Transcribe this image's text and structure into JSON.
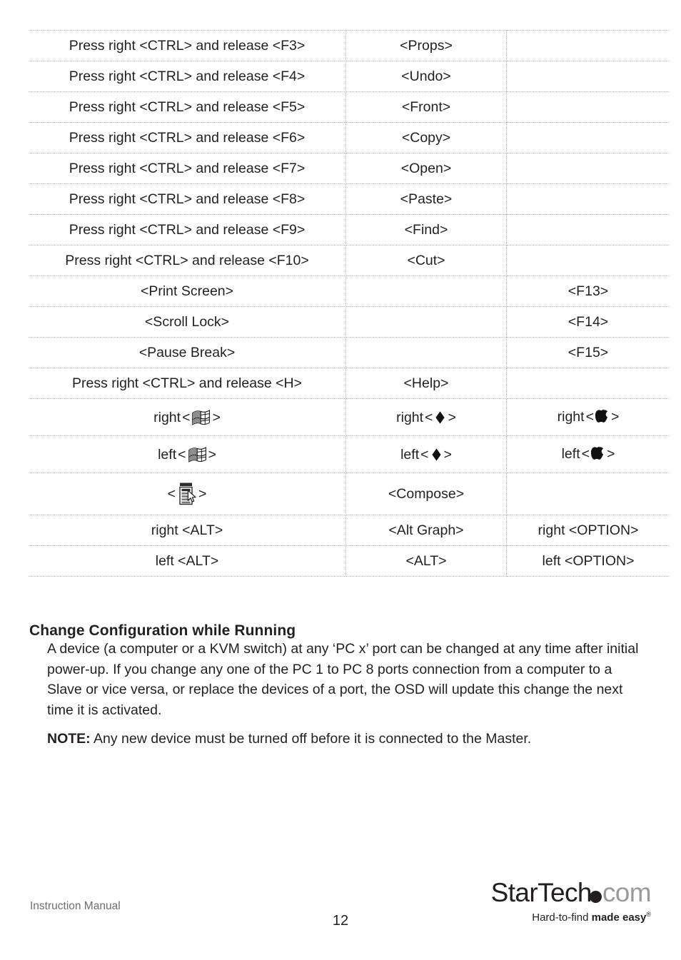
{
  "page": {
    "number": "12",
    "footer_label": "Instruction Manual"
  },
  "key_table": {
    "rows": [
      {
        "pc": "Press right <CTRL> and release <F3>",
        "sun": "<Props>",
        "mac": ""
      },
      {
        "pc": "Press right <CTRL> and release <F4>",
        "sun": "<Undo>",
        "mac": ""
      },
      {
        "pc": "Press right <CTRL> and release <F5>",
        "sun": "<Front>",
        "mac": ""
      },
      {
        "pc": "Press right <CTRL> and release <F6>",
        "sun": "<Copy>",
        "mac": ""
      },
      {
        "pc": "Press right <CTRL> and release <F7>",
        "sun": "<Open>",
        "mac": ""
      },
      {
        "pc": "Press right <CTRL> and release <F8>",
        "sun": "<Paste>",
        "mac": ""
      },
      {
        "pc": "Press right <CTRL> and release <F9>",
        "sun": "<Find>",
        "mac": ""
      },
      {
        "pc": "Press right <CTRL> and release <F10>",
        "sun": "<Cut>",
        "mac": ""
      },
      {
        "pc": "<Print Screen>",
        "sun": "",
        "mac": "<F13>"
      },
      {
        "pc": "<Scroll Lock>",
        "sun": "",
        "mac": "<F14>"
      },
      {
        "pc": "<Pause Break>",
        "sun": "",
        "mac": "<F15>"
      },
      {
        "pc": "Press right <CTRL> and release <H>",
        "sun": "<Help>",
        "mac": ""
      }
    ],
    "symbol_rows": [
      {
        "pc_prefix": "right",
        "pc_icon": "windows-flag-icon",
        "sun_prefix": "right",
        "sun_icon": "sun-diamond-icon",
        "mac_prefix": "right",
        "mac_icon": "apple-logo-icon"
      },
      {
        "pc_prefix": "left",
        "pc_icon": "windows-flag-icon",
        "sun_prefix": "left",
        "sun_icon": "sun-diamond-icon",
        "mac_prefix": "left",
        "mac_icon": "apple-logo-icon"
      }
    ],
    "compose_row": {
      "pc_prefix": "",
      "pc_icon": "context-menu-key-icon",
      "sun": "<Compose>",
      "mac": ""
    },
    "alt_rows": [
      {
        "pc": "right <ALT>",
        "sun": "<Alt Graph>",
        "mac": "right <OPTION>"
      },
      {
        "pc": "left <ALT>",
        "sun": "<ALT>",
        "mac": "left <OPTION>"
      }
    ],
    "angle_open": "<",
    "angle_close": ">"
  },
  "section": {
    "heading": "Change Configuration while Running",
    "paragraph": "A device (a computer or a KVM switch) at any ‘PC x’ port can be changed at any time after initial power-up. If you change any one of the PC 1 to PC 8 ports connection from a computer to a Slave or vice versa, or replace the devices of a port, the OSD will update this change the next time it is activated.",
    "note_label": "NOTE:",
    "note_text": " Any new device must be turned off before it is connected to the Master."
  },
  "logo": {
    "brand_dark": "StarTech",
    "brand_light": "com",
    "tagline_light": "Hard-to-find ",
    "tagline_bold": "made easy",
    "registered": "®",
    "color_dark": "#231f20",
    "color_light": "#9a9a9a"
  }
}
